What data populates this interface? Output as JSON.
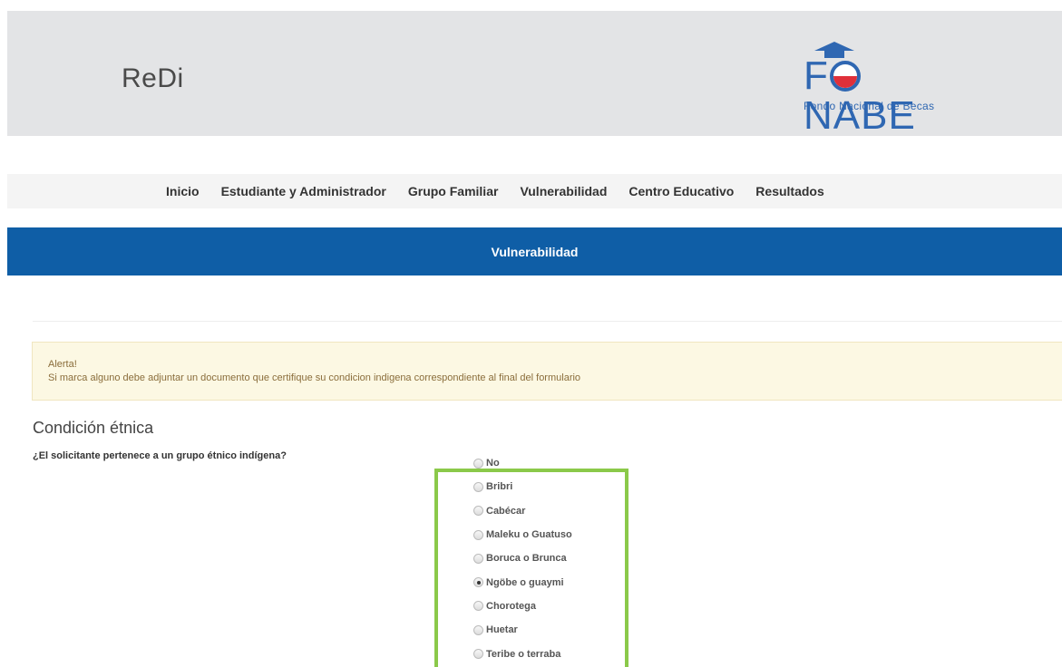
{
  "header": {
    "brand": "ReDi",
    "logo": {
      "word_left": "F",
      "word_right": "NABE",
      "tagline": "Fondo Nacional de Becas",
      "colors": {
        "blue": "#2f67b2",
        "red": "#e0303a"
      }
    }
  },
  "nav": {
    "items": [
      {
        "label": "Inicio"
      },
      {
        "label": "Estudiante y Administrador"
      },
      {
        "label": "Grupo Familiar"
      },
      {
        "label": "Vulnerabilidad"
      },
      {
        "label": "Centro Educativo"
      },
      {
        "label": "Resultados"
      }
    ]
  },
  "section": {
    "title": "Vulnerabilidad",
    "color": "#0f5ea6"
  },
  "alert": {
    "heading": "Alerta!",
    "message": "Si marca alguno debe adjuntar un documento que certifique su condicion indigena correspondiente al final del formulario"
  },
  "form": {
    "section_title": "Condición étnica",
    "question": "¿El solicitante pertenece a un grupo étnico indígena?",
    "options": [
      {
        "label": "No",
        "checked": false
      },
      {
        "label": "Bribri",
        "checked": false
      },
      {
        "label": "Cabécar",
        "checked": false
      },
      {
        "label": "Maleku o Guatuso",
        "checked": false
      },
      {
        "label": "Boruca o Brunca",
        "checked": false
      },
      {
        "label": "Ngöbe o guaymi",
        "checked": true
      },
      {
        "label": "Chorotega",
        "checked": false
      },
      {
        "label": "Huetar",
        "checked": false
      },
      {
        "label": "Teribe o terraba",
        "checked": false
      }
    ],
    "highlight_color": "#8bc94a"
  }
}
